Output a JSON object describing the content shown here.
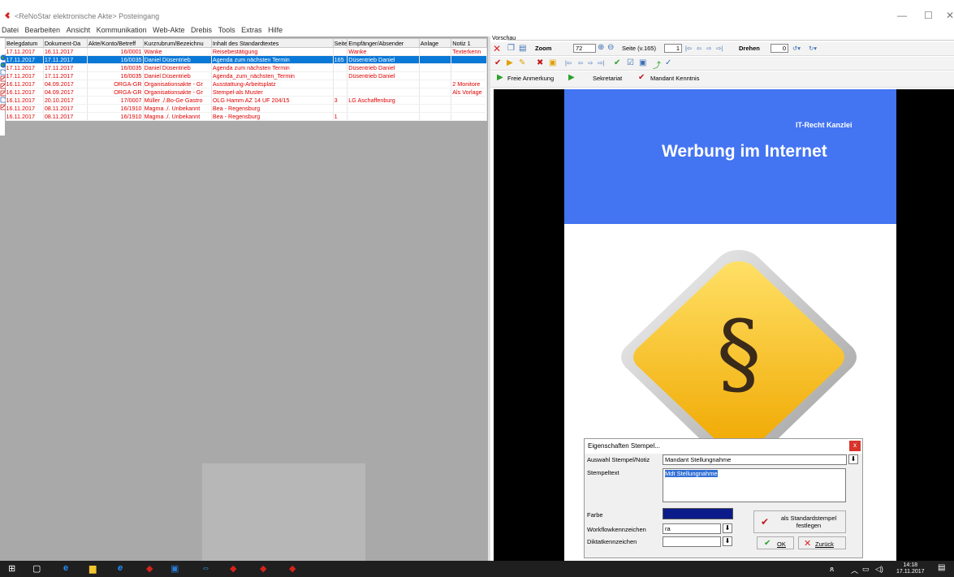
{
  "window": {
    "title": "<ReNoStar elektronische Akte> Posteingang",
    "controls": [
      "—",
      "☐",
      "✕"
    ]
  },
  "menu": [
    "Datei",
    "Bearbeiten",
    "Ansicht",
    "Kommunikation",
    "Web-Akte",
    "Drebis",
    "Tools",
    "Extras",
    "Hilfe"
  ],
  "table": {
    "columns": [
      "Belegdatum",
      "Dokument-Da",
      "Akte/Konto/Betreff",
      "Kurzrubrum/Bezeichnu",
      "Inhalt des Standardtextes",
      "Seite",
      "Empfänger/Absender",
      "Anlage",
      "Notiz 1"
    ],
    "rows": [
      [
        "17.11.2017",
        "16.11.2017",
        "16/0001",
        "Wanke",
        "Reisebestätigung",
        "",
        "Wanke",
        "",
        "Texterkenn"
      ],
      [
        "17.11.2017",
        "17.11.2017",
        "16/0035",
        "Daniel Düsentrieb",
        "Agenda zum nächsten Termin",
        "165",
        "Düsentrieb Daniel",
        "",
        ""
      ],
      [
        "17.11.2017",
        "17.11.2017",
        "16/0035",
        "Daniel Düsentrieb",
        "Agenda zum nächsten Termin",
        "",
        "Düsentrieb Daniel",
        "",
        ""
      ],
      [
        "17.11.2017",
        "17.11.2017",
        "16/0035",
        "Daniel Düsentrieb",
        "Agenda_zum_nächsten_Termin",
        "",
        "Düsentrieb Daniel",
        "",
        ""
      ],
      [
        "16.11.2017",
        "04.09.2017",
        "ORGA-GR",
        "Organisationsakte - Gr",
        "Ausstattung-Arbeitsplatz",
        "",
        "",
        "",
        "2 Monitore"
      ],
      [
        "16.11.2017",
        "04.09.2017",
        "ORGA-GR",
        "Organisationsakte - Gr",
        "Stempel-als Muster",
        "",
        "",
        "",
        "Als Vorlage"
      ],
      [
        "16.11.2017",
        "20.10.2017",
        "17/0007",
        "Müller ./.Bo-Ge Gastro",
        "OLG Hamm AZ 14 UF 204/15",
        "3",
        "LG Aschaffenburg",
        "",
        ""
      ],
      [
        "16.11.2017",
        "08.11.2017",
        "16/1910",
        "Magma ./. Unbekannt",
        "Bea - Regensburg",
        "",
        "",
        "",
        ""
      ],
      [
        "16.11.2017",
        "08.11.2017",
        "16/1910",
        "Magma ./. Unbekannt",
        "Bea - Regensburg",
        "1",
        "",
        "",
        ""
      ]
    ],
    "selected_row": 1
  },
  "preview": {
    "label": "Vorschau",
    "zoom_label": "Zoom",
    "zoom_value": "72",
    "page_label": "Seite (v.165)",
    "page_value": "1",
    "rotate_label": "Drehen",
    "rotate_value": "0",
    "buttons": [
      "Freie Anmerkung",
      "Sekretariat",
      "Mandant Kenntnis"
    ],
    "doc_firm": "IT-Recht Kanzlei",
    "doc_title": "Werbung im Internet",
    "doc_symbol": "§"
  },
  "dialog": {
    "title": "Eigenschaften Stempel...",
    "close": "x",
    "auswahl_label": "Auswahl Stempel/Notiz",
    "auswahl_value": "Mandant Stellungnahme",
    "stempeltext_label": "Stempeltext",
    "stempeltext_value": "Mdt Stellungnahme",
    "farbe_label": "Farbe",
    "farbe_color": "#0b1b8a",
    "workflow_label": "Workflowkennzeichen",
    "workflow_value": "ra",
    "diktat_label": "Diktatkennzeichen",
    "diktat_value": "",
    "standard_button": "als Standardstempel festlegen",
    "ok_button": "OK",
    "zurueck_button": "Zurück"
  },
  "taskbar": {
    "time": "14:18",
    "date": "17.11.2017"
  }
}
